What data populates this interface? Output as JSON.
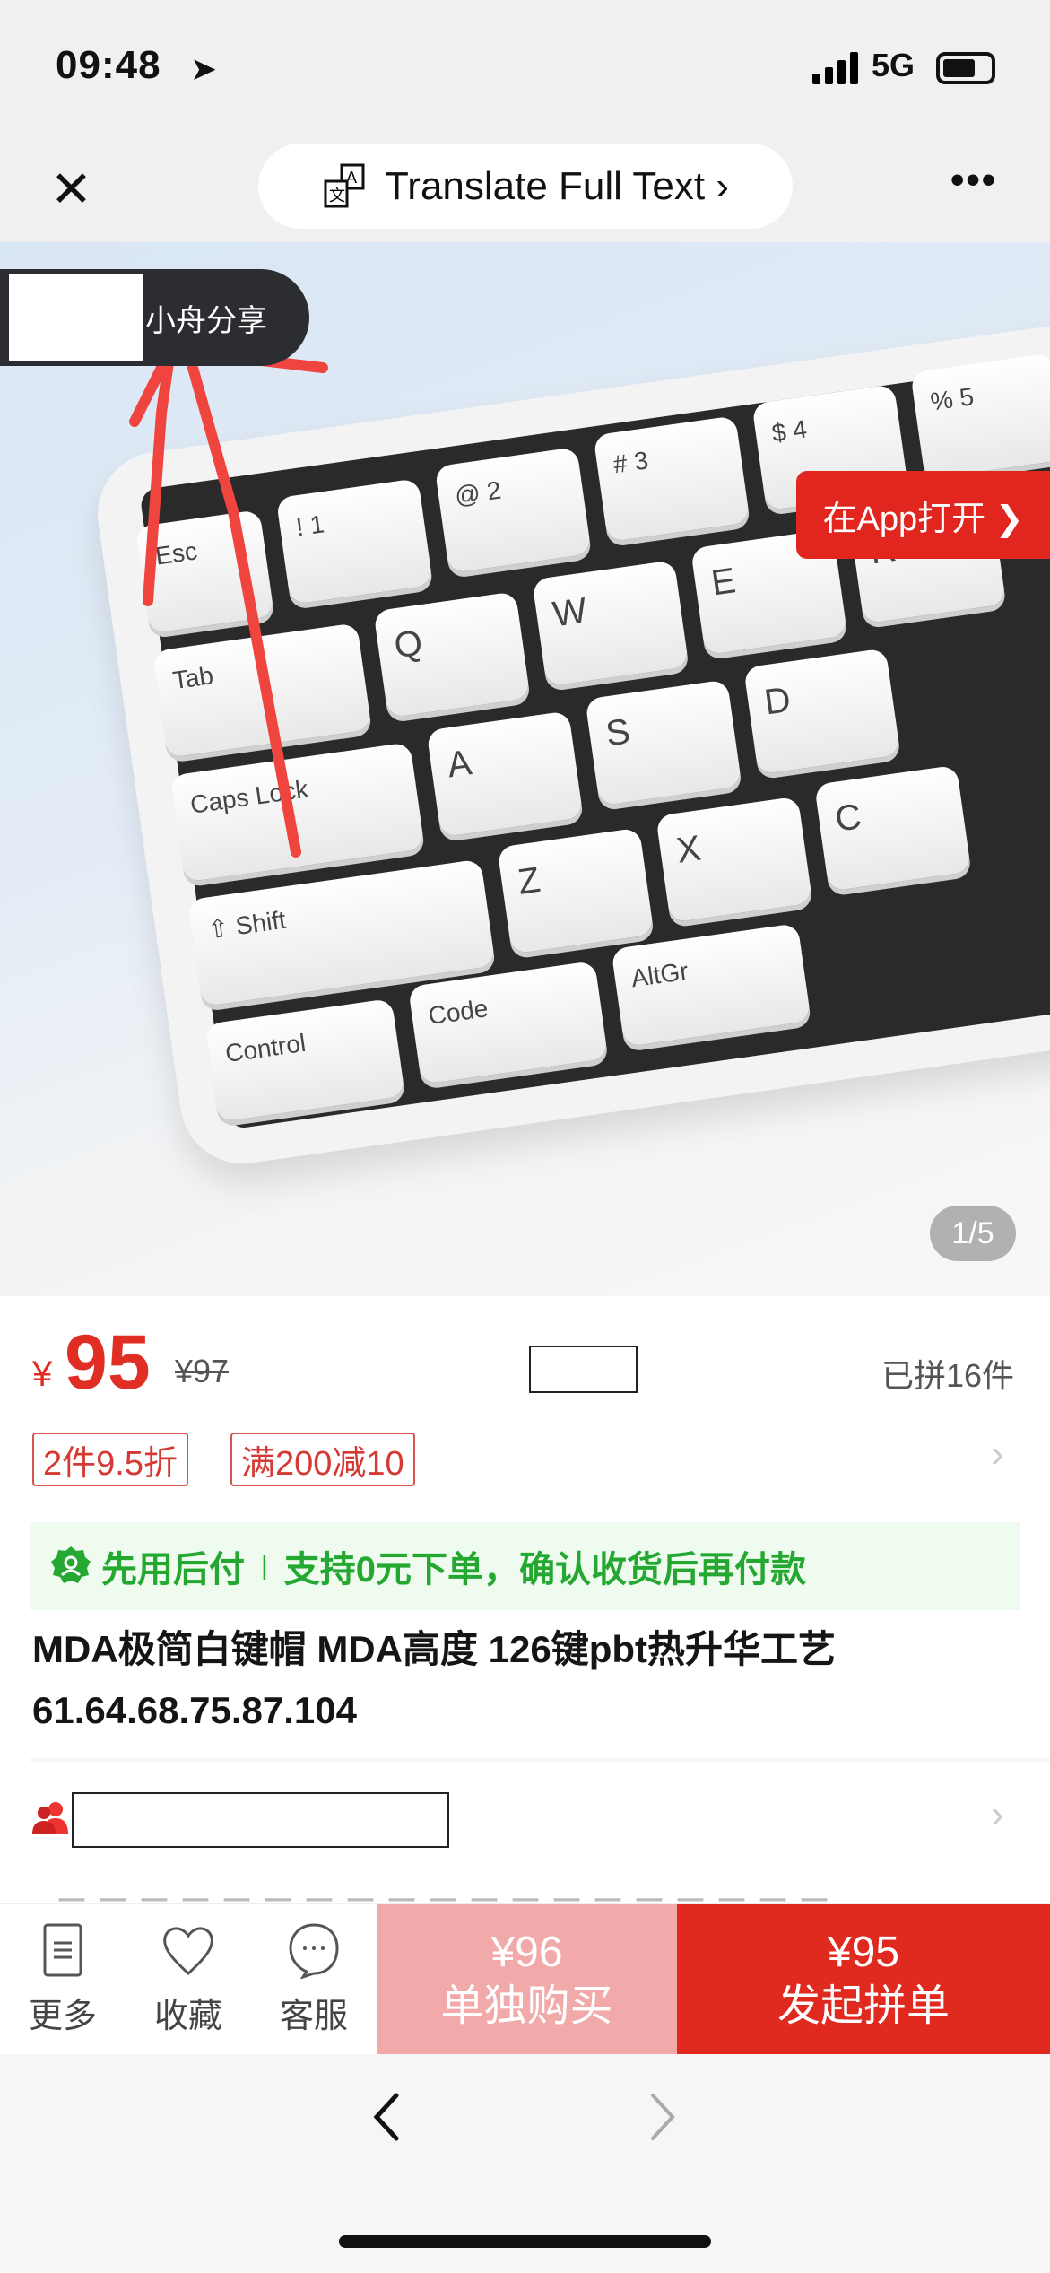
{
  "status_bar": {
    "time": "09:48",
    "network": "5G",
    "battery_level": 0.7
  },
  "nav": {
    "translate_label": "Translate Full Text ›",
    "translate_icon": "translate-icon",
    "close_icon": "close-icon",
    "more_icon": "more-icon"
  },
  "hero": {
    "share_label": "小舟分享",
    "open_app_label": "在App打开 ❯",
    "pager": "1/5",
    "keycaps": [
      "Esc",
      "! 1",
      "@ 2",
      "# 3",
      "$ 4",
      "% 5",
      "Q",
      "W",
      "E",
      "R",
      "Tab",
      "A",
      "S",
      "D",
      "Caps Lock",
      "Z",
      "X",
      "C",
      "⇧ Shift",
      "Code",
      "AltGr",
      "Control"
    ]
  },
  "product": {
    "currency": "¥",
    "price": "95",
    "original_price": "¥97",
    "sold": "已拼16件",
    "tags": [
      "2件9.5折",
      "满200减10"
    ],
    "pay_later": {
      "title": "先用后付",
      "desc": "支持0元下单，确认收货后再付款"
    },
    "title": "MDA极简白键帽 MDA高度 126键pbt热升华工艺 61.64.68.75.87.104",
    "partial_text": "二二二二二二二二二二二二二二二二二二二"
  },
  "bottom_bar": {
    "more": "更多",
    "favorite": "收藏",
    "service": "客服",
    "solo_price": "¥96",
    "solo_label": "单独购买",
    "group_price": "¥95",
    "group_label": "发起拼单"
  },
  "colors": {
    "accent": "#e0291f",
    "green": "#25a832"
  }
}
